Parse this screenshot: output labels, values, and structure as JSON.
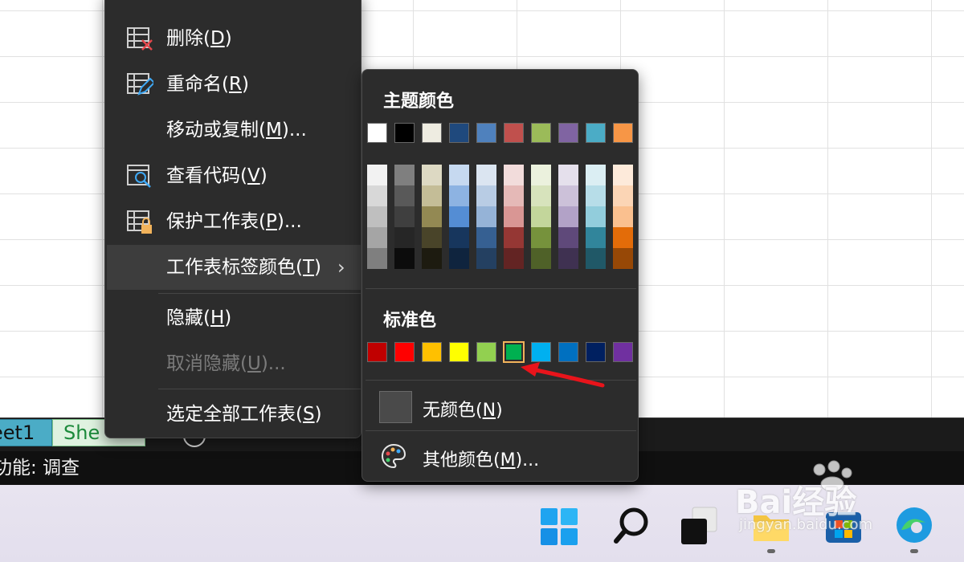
{
  "sheet_tabs": [
    "eet1",
    "She"
  ],
  "status_text": "功能: 调查",
  "context_menu": {
    "items": [
      {
        "label": "删除(D)",
        "icon": "delete-sheet-icon"
      },
      {
        "label": "重命名(R)",
        "icon": "rename-sheet-icon"
      },
      {
        "label": "移动或复制(M)...",
        "icon": ""
      },
      {
        "label": "查看代码(V)",
        "icon": "view-code-icon"
      },
      {
        "label": "保护工作表(P)...",
        "icon": "protect-sheet-icon"
      },
      {
        "label": "工作表标签颜色(T)",
        "icon": "",
        "submenu": true
      },
      {
        "label": "隐藏(H)",
        "icon": ""
      },
      {
        "label": "取消隐藏(U)...",
        "icon": "",
        "disabled": true
      },
      {
        "label": "选定全部工作表(S)",
        "icon": ""
      }
    ],
    "submenu_indicator": "›"
  },
  "color_panel": {
    "theme_title": "主题颜色",
    "theme_colors": [
      "#ffffff",
      "#000000",
      "#eeece1",
      "#1f497d",
      "#4f81bd",
      "#c0504d",
      "#9bbb59",
      "#8064a2",
      "#4bacc6",
      "#f79646"
    ],
    "theme_shades": [
      [
        "#f2f2f2",
        "#d8d8d8",
        "#bfbfbf",
        "#a5a5a5",
        "#7f7f7f"
      ],
      [
        "#7f7f7f",
        "#595959",
        "#3f3f3f",
        "#262626",
        "#0c0c0c"
      ],
      [
        "#ddd9c3",
        "#c4bd97",
        "#938953",
        "#494429",
        "#1d1b10"
      ],
      [
        "#c6d9f0",
        "#8db3e2",
        "#548dd4",
        "#17365d",
        "#0f243e"
      ],
      [
        "#dbe5f1",
        "#b8cce4",
        "#95b3d7",
        "#366092",
        "#244061"
      ],
      [
        "#f2dcdb",
        "#e5b9b7",
        "#d99694",
        "#953734",
        "#632423"
      ],
      [
        "#ebf1dd",
        "#d7e3bc",
        "#c3d69b",
        "#76923c",
        "#4f6128"
      ],
      [
        "#e5e0ec",
        "#ccc1d9",
        "#b2a2c7",
        "#5f497a",
        "#3f3151"
      ],
      [
        "#dbeef3",
        "#b7dde8",
        "#92cddc",
        "#31859b",
        "#205867"
      ],
      [
        "#fdeada",
        "#fbd5b5",
        "#fac08f",
        "#e36c09",
        "#974806"
      ]
    ],
    "standard_title": "标准色",
    "standard_colors": [
      "#c00000",
      "#ff0000",
      "#ffc000",
      "#ffff00",
      "#92d050",
      "#00b050",
      "#00b0f0",
      "#0070c0",
      "#002060",
      "#7030a0"
    ],
    "selected_standard_index": 5,
    "no_color_label": "无颜色(N)",
    "more_colors_label": "其他颜色(M)..."
  },
  "taskbar": {
    "icons": [
      "windows-start-icon",
      "search-icon",
      "task-view-icon",
      "file-explorer-icon",
      "microsoft-store-icon",
      "edge-browser-icon"
    ]
  },
  "watermark": {
    "line1": "Bai经验",
    "line2": "jingyan.baidu.com"
  },
  "annotation": {
    "arrow_color": "#e8141b"
  }
}
